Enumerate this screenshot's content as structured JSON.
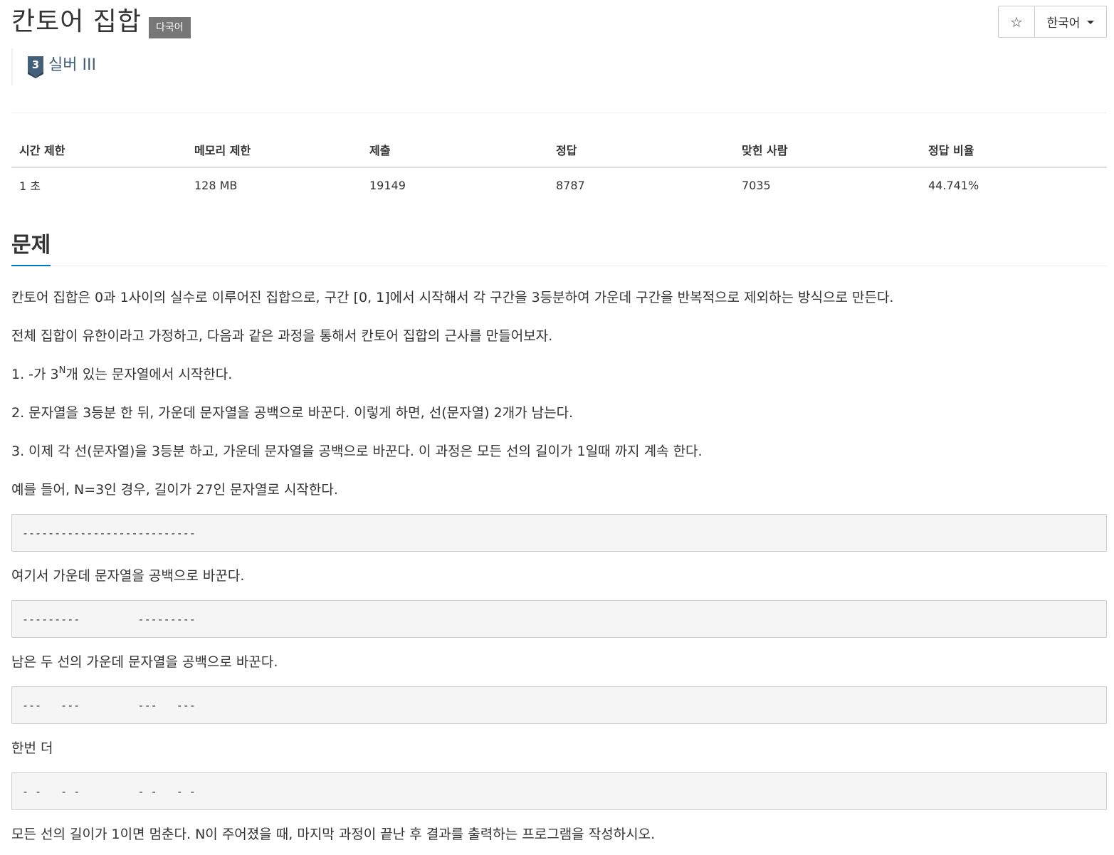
{
  "header": {
    "title": "칸토어 집합",
    "badge": "다국어",
    "star_icon": "☆",
    "language": "한국어"
  },
  "tier": {
    "level": "3",
    "label": "실버 III",
    "color": "#435f7a"
  },
  "info_table": {
    "headers": [
      "시간 제한",
      "메모리 제한",
      "제출",
      "정답",
      "맞힌 사람",
      "정답 비율"
    ],
    "values": [
      "1 초",
      "128 MB",
      "19149",
      "8787",
      "7035",
      "44.741%"
    ]
  },
  "section": {
    "title": "문제"
  },
  "problem": {
    "p1": "칸토어 집합은 0과 1사이의 실수로 이루어진 집합으로, 구간 [0, 1]에서 시작해서 각 구간을 3등분하여 가운데 구간을 반복적으로 제외하는 방식으로 만든다.",
    "p2": "전체 집합이 유한이라고 가정하고, 다음과 같은 과정을 통해서 칸토어 집합의 근사를 만들어보자.",
    "p3_prefix": "1. -가 3",
    "p3_sup": "N",
    "p3_suffix": "개 있는 문자열에서 시작한다.",
    "p4": "2. 문자열을 3등분 한 뒤, 가운데 문자열을 공백으로 바꾼다. 이렇게 하면, 선(문자열) 2개가 남는다.",
    "p5": "3. 이제 각 선(문자열)을 3등분 하고, 가운데 문자열을 공백으로 바꾼다. 이 과정은 모든 선의 길이가 1일때 까지 계속 한다.",
    "p6": "예를 들어, N=3인 경우, 길이가 27인 문자열로 시작한다.",
    "code1": "---------------------------",
    "p7": "여기서 가운데 문자열을 공백으로 바꾼다.",
    "code2": "---------         ---------",
    "p8": "남은 두 선의 가운데 문자열을 공백으로 바꾼다.",
    "code3": "---   ---         ---   ---",
    "p9": "한번 더",
    "code4": "- -   - -         - -   - -",
    "p10": "모든 선의 길이가 1이면 멈춘다. N이 주어졌을 때, 마지막 과정이 끝난 후 결과를 출력하는 프로그램을 작성하시오."
  }
}
